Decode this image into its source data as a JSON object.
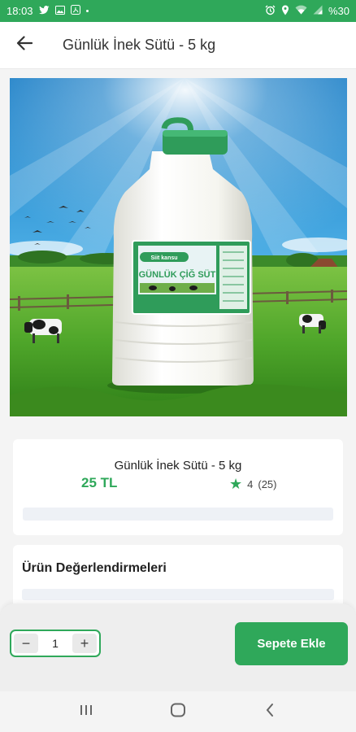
{
  "status_bar": {
    "time": "18:03",
    "battery": "%30",
    "icons_left": [
      "twitter-icon",
      "image-icon",
      "app-icon"
    ],
    "icons_right": [
      "alarm-icon",
      "location-icon",
      "wifi-icon",
      "signal-icon"
    ]
  },
  "header": {
    "title": "Günlük İnek Sütü - 5 kg"
  },
  "product": {
    "name": "Günlük İnek Sütü - 5 kg",
    "price": "25 TL",
    "rating": "4",
    "rating_count": "(25)",
    "carousel_active": 1,
    "carousel_total": 1
  },
  "label": {
    "brand": "Siit kansu",
    "name": "GÜNLÜK ÇİĞ SÜT"
  },
  "reviews": {
    "title": "Ürün Değerlendirmeleri"
  },
  "cart": {
    "quantity": "1",
    "minus_label": "−",
    "plus_label": "+",
    "add_label": "Sepete Ekle"
  },
  "colors": {
    "accent": "#2fa85a",
    "background": "#f4f4f4"
  }
}
